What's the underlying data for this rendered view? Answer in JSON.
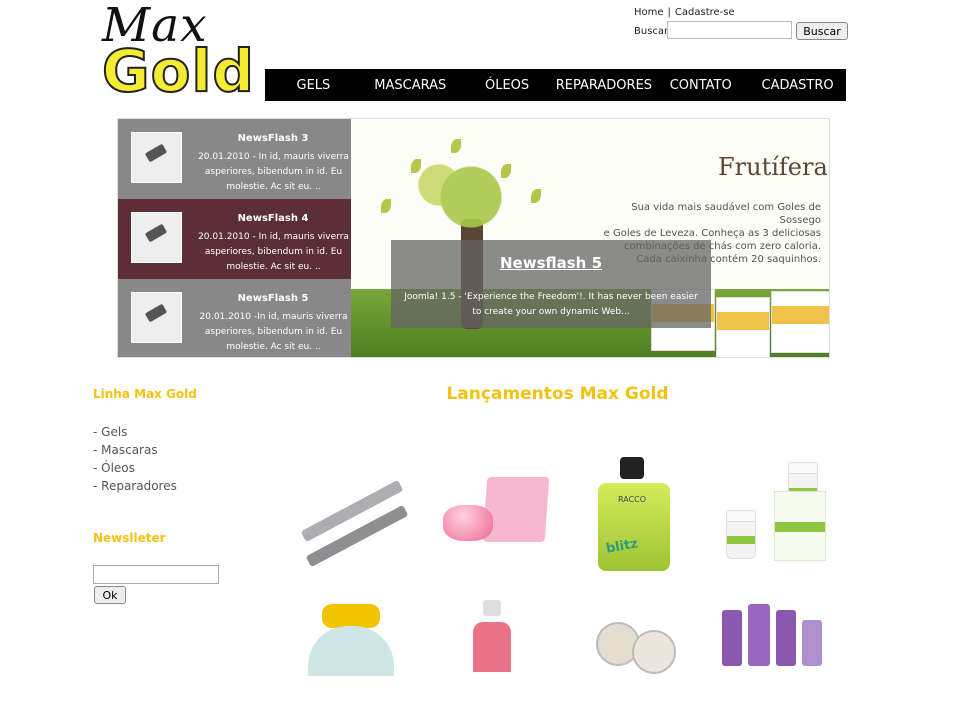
{
  "brand": {
    "line1": "Max",
    "line2": "Gold"
  },
  "top_links": {
    "home": "Home",
    "separator": "|",
    "register": "Cadastre-se"
  },
  "search": {
    "label": "Buscar",
    "value": "",
    "button": "Buscar"
  },
  "nav": {
    "items": [
      "GELS",
      "MASCARAS",
      "ÓLEOS",
      "REPARADORES",
      "CONTATO",
      "CADASTRO"
    ]
  },
  "slideshow": {
    "items": [
      {
        "title": "NewsFlash 3",
        "text": "20.01.2010 - In id, mauris viverra asperiores, bibendum in id. Eu molestie. Ac sit eu. ..",
        "active": false
      },
      {
        "title": "NewsFlash 4",
        "text": "20.01.2010 - In id, mauris viverra asperiores, bibendum in id. Eu molestie. Ac sit eu. ..",
        "active": true
      },
      {
        "title": "NewsFlash 5",
        "text": "20.01.2010 -In id, mauris viverra asperiores, bibendum in id. Eu molestie. Ac sit eu. ..",
        "active": false
      }
    ],
    "banner": {
      "brand": "Frutífera",
      "copy_line1": "Sua vida mais saudável com Goles de Sossego",
      "copy_line2": "e Goles de Leveza. Conheça as 3 deliciosas",
      "copy_line3": "combinações de chás com zero caloria.",
      "copy_line4": "Cada caixinha contém 20 saquinhos.",
      "box_label": "frutífera"
    },
    "overlay": {
      "title": "Newsflash 5",
      "text": "Joomla! 1.5 - 'Experience the Freedom'!. It has never been easier to create your own dynamic Web..."
    },
    "active_color": "#5c2f37",
    "inactive_color": "#888888"
  },
  "sidebar": {
    "line_heading": "Linha Max Gold",
    "line_items": [
      "- Gels",
      "- Mascaras",
      "- Óleos",
      "- Reparadores"
    ],
    "newsletter_heading": "Newslleter",
    "newsletter_value": "",
    "newsletter_button": "Ok"
  },
  "main": {
    "heading": "Lançamentos Max Gold",
    "products": [
      {
        "name": "mascara"
      },
      {
        "name": "pink-cream-jar-and-box"
      },
      {
        "name": "blitz-perfume",
        "label": "blitz",
        "brand": "RACCO"
      },
      {
        "name": "supplement-jars"
      },
      {
        "name": "yellow-cap-bottle"
      },
      {
        "name": "pink-pump-bottle"
      },
      {
        "name": "eyeshadow-compacts"
      },
      {
        "name": "purple-tubes"
      }
    ]
  },
  "colors": {
    "accent": "#f2c211",
    "nav_bg": "#000000",
    "logo_yellow": "#f4ec33"
  }
}
